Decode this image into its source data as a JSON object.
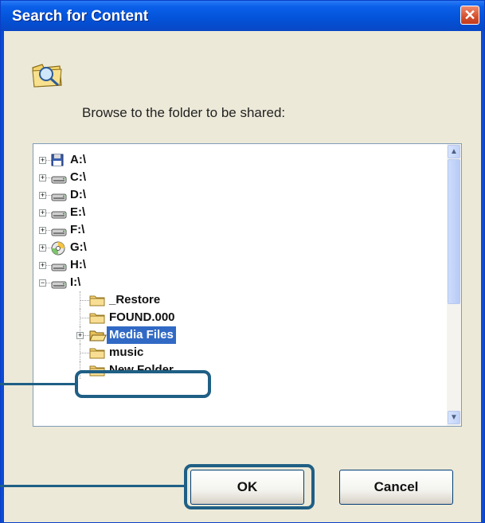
{
  "window": {
    "title": "Search for Content"
  },
  "dialog": {
    "prompt": "Browse to the folder to be shared:"
  },
  "tree": {
    "items": [
      {
        "label": "A:\\",
        "icon": "floppy-drive-icon",
        "expander": "+"
      },
      {
        "label": "C:\\",
        "icon": "hard-drive-icon",
        "expander": "+"
      },
      {
        "label": "D:\\",
        "icon": "hard-drive-icon",
        "expander": "+"
      },
      {
        "label": "E:\\",
        "icon": "hard-drive-icon",
        "expander": "+"
      },
      {
        "label": "F:\\",
        "icon": "hard-drive-icon",
        "expander": "+"
      },
      {
        "label": "G:\\",
        "icon": "cd-drive-icon",
        "expander": "+"
      },
      {
        "label": "H:\\",
        "icon": "hard-drive-icon",
        "expander": "+"
      },
      {
        "label": "I:\\",
        "icon": "hard-drive-icon",
        "expander": "−"
      },
      {
        "label": "_Restore",
        "icon": "folder-icon"
      },
      {
        "label": "FOUND.000",
        "icon": "folder-icon"
      },
      {
        "label": "Media Files",
        "icon": "open-folder-icon",
        "expander": "+",
        "selected": true
      },
      {
        "label": "music",
        "icon": "folder-icon"
      },
      {
        "label": "New Folder",
        "icon": "folder-icon"
      }
    ]
  },
  "buttons": {
    "ok": "OK",
    "cancel": "Cancel"
  },
  "colors": {
    "titlebar": "#0352d8",
    "selection": "#316ac5",
    "callout": "#1f5f85",
    "dialog_bg": "#ece9d8"
  }
}
